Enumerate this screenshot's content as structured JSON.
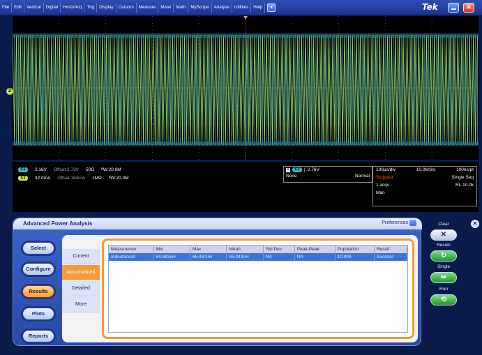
{
  "menubar": {
    "items": [
      "File",
      "Edit",
      "Vertical",
      "Digital",
      "Horiz/Acq",
      "Trig",
      "Display",
      "Cursors",
      "Measure",
      "Mask",
      "Math",
      "MyScope",
      "Analyze",
      "Utilities",
      "Help"
    ],
    "brand": "Tek"
  },
  "scope": {
    "channel_marker": "2"
  },
  "readout": {
    "ch1": {
      "badge": "C1",
      "scale": "2.16V",
      "offset": "Offset:2.73V",
      "impedance": "50Ω",
      "bw": "ᴮW:20.0M"
    },
    "ch2": {
      "badge": "C2",
      "scale": "32.0mA",
      "offset": "Offset:184mA",
      "impedance": "1MΩ",
      "bw": "ᴮW:20.0M"
    },
    "trigger": {
      "badge": "C1",
      "prefix": "A",
      "level": "2.76V",
      "coupling": "None",
      "mode": "Normal"
    },
    "acq": {
      "timebase": "100µs/div",
      "sample_rate": "10.0MS/s",
      "resolution": "100ns/pt",
      "state": "Stopped",
      "seq": "Single Seq",
      "acqs": "1 acqs",
      "record_length": "RL:10.0k",
      "mode": "Man"
    }
  },
  "panel": {
    "title": "Advanced Power Analysis",
    "preferences": "Preferences",
    "side_buttons": [
      "Select",
      "Configure",
      "Results",
      "Plots",
      "Reports"
    ],
    "active_side": "Results",
    "tabs": [
      "Current",
      "Accumulated",
      "Detailed",
      "More"
    ],
    "active_tab": "Accumulated",
    "table": {
      "headers": [
        "Measuremer",
        "Min",
        "Max",
        "Mean",
        "Std Dev",
        "Peak-Peak",
        "Population",
        "Result"
      ],
      "rows": [
        [
          "Inductance0",
          "64.683uH",
          "65.487uH",
          "65.043uH",
          "NA",
          "NA",
          "10.000",
          "Success"
        ]
      ]
    }
  },
  "controls": {
    "clear": "Clear",
    "recalc": "Recalc",
    "single": "Single",
    "run": "Run"
  }
}
